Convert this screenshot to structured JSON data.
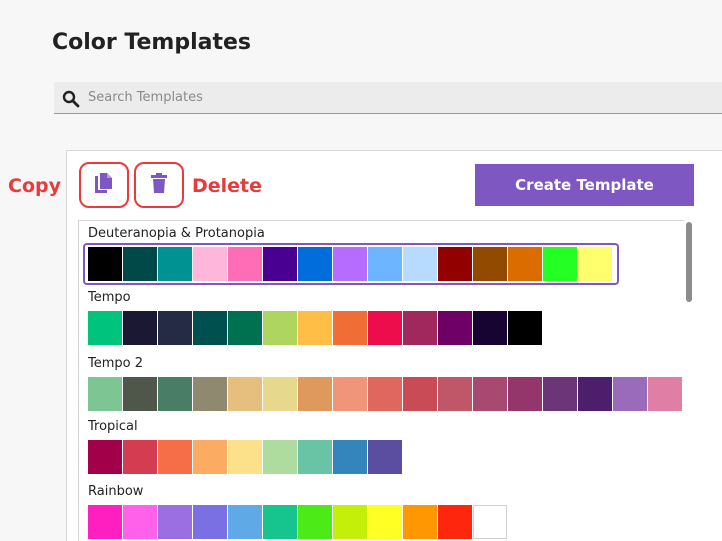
{
  "page_title": "Color Templates",
  "search": {
    "placeholder": "Search Templates",
    "value": ""
  },
  "annotations": {
    "copy": "Copy",
    "delete": "Delete"
  },
  "toolbar": {
    "create_label": "Create Template"
  },
  "accent": "#7e57c2",
  "annotation_color": "#ea3a3a",
  "icons": {
    "search": "search-icon",
    "copy": "copy-icon",
    "delete": "trash-icon"
  },
  "templates": [
    {
      "name": "Deuteranopia & Protanopia",
      "selected": true,
      "colors": [
        "#000000",
        "#004949",
        "#009292",
        "#ffb6db",
        "#ff6db6",
        "#490092",
        "#006ddb",
        "#b66dff",
        "#6db6ff",
        "#b6dbff",
        "#920000",
        "#924900",
        "#db6d00",
        "#24ff24",
        "#ffff6d"
      ]
    },
    {
      "name": "Tempo",
      "selected": false,
      "colors": [
        "#00c37e",
        "#1a1833",
        "#262b45",
        "#005050",
        "#007150",
        "#aed55e",
        "#ffbe46",
        "#f06d36",
        "#ed0d4d",
        "#a1285c",
        "#6f0065",
        "#170433",
        "#000000"
      ]
    },
    {
      "name": "Tempo 2",
      "selected": false,
      "colors": [
        "#7dc593",
        "#4f574a",
        "#497d66",
        "#8f8a6f",
        "#e6bf7e",
        "#e6d88d",
        "#e0995c",
        "#f0957a",
        "#e0675e",
        "#c84b56",
        "#c05769",
        "#a84972",
        "#94356c",
        "#6c3577",
        "#4d1e6b",
        "#9b6bbb",
        "#e07fa5"
      ]
    },
    {
      "name": "Tropical",
      "selected": false,
      "colors": [
        "#a3004a",
        "#d43d51",
        "#f56e47",
        "#fbab62",
        "#fce08a",
        "#addc9e",
        "#69c3a5",
        "#3385bb",
        "#5b4ea1"
      ]
    },
    {
      "name": "Rainbow",
      "selected": false,
      "colors": [
        "#ff1fc0",
        "#ff61ea",
        "#9b6fe1",
        "#7a6fe3",
        "#5fa9e6",
        "#16c58e",
        "#4cea17",
        "#c4ef09",
        "#ffff24",
        "#ff9703",
        "#ff260e",
        "#ffffff"
      ]
    }
  ]
}
